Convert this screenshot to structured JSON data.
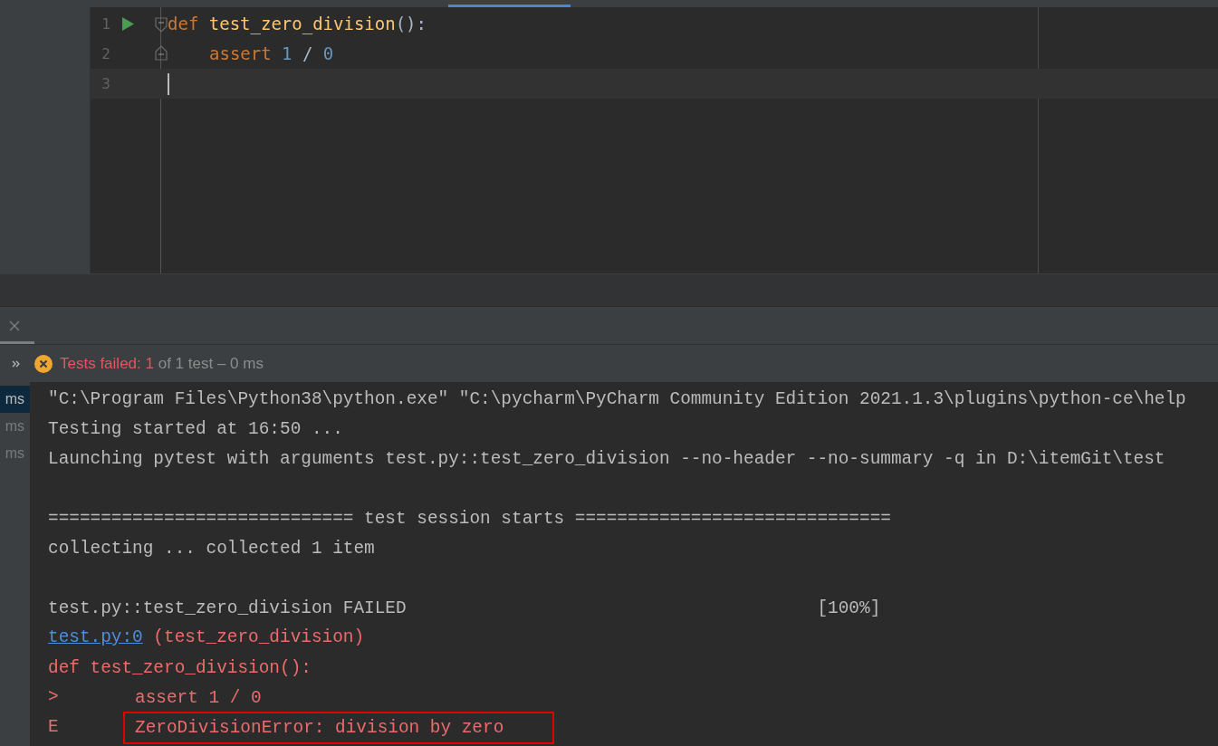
{
  "editor": {
    "lines": [
      {
        "number": "1",
        "run_marker": true,
        "fold_start": true,
        "fold_end": false,
        "indented": false,
        "current": false,
        "tokens": [
          {
            "kind": "keyword",
            "text": "def "
          },
          {
            "kind": "function",
            "text": "test_zero_division"
          },
          {
            "kind": "plain",
            "text": "():"
          }
        ]
      },
      {
        "number": "2",
        "run_marker": false,
        "fold_start": false,
        "fold_end": true,
        "indented": true,
        "current": false,
        "tokens": [
          {
            "kind": "keyword",
            "text": "assert "
          },
          {
            "kind": "number",
            "text": "1"
          },
          {
            "kind": "plain",
            "text": " / "
          },
          {
            "kind": "number",
            "text": "0"
          }
        ]
      },
      {
        "number": "3",
        "run_marker": false,
        "fold_start": false,
        "fold_end": false,
        "indented": false,
        "current": true
      }
    ]
  },
  "run_panel": {
    "status": {
      "failed_label": "Tests failed: 1",
      "rest": " of 1 test – 0 ms"
    },
    "tree_items": [
      {
        "label": "ms",
        "selected": true
      },
      {
        "label": "ms",
        "selected": false
      },
      {
        "label": "ms",
        "selected": false
      }
    ],
    "console": [
      {
        "kind": "plain",
        "text": "\"C:\\Program Files\\Python38\\python.exe\" \"C:\\pycharm\\PyCharm Community Edition 2021.1.3\\plugins\\python-ce\\help"
      },
      {
        "kind": "plain",
        "text": "Testing started at 16:50 ..."
      },
      {
        "kind": "plain",
        "text": "Launching pytest with arguments test.py::test_zero_division --no-header --no-summary -q in D:\\itemGit\\test"
      },
      {
        "kind": "blank"
      },
      {
        "kind": "plain",
        "text": "============================= test session starts =============================="
      },
      {
        "kind": "plain",
        "text": "collecting ... collected 1 item"
      },
      {
        "kind": "blank"
      },
      {
        "kind": "plain",
        "text": "test.py::test_zero_division FAILED                                       [100%]"
      },
      {
        "kind": "link",
        "link": "test.py:0",
        "text": " (test_zero_division)"
      },
      {
        "kind": "error",
        "text": "def test_zero_division():"
      },
      {
        "kind": "error",
        "marker": ">",
        "text": "assert 1 / 0",
        "highlighted": false
      },
      {
        "kind": "error",
        "marker": "E",
        "text": "ZeroDivisionError: division by zero",
        "highlighted": true
      }
    ]
  }
}
